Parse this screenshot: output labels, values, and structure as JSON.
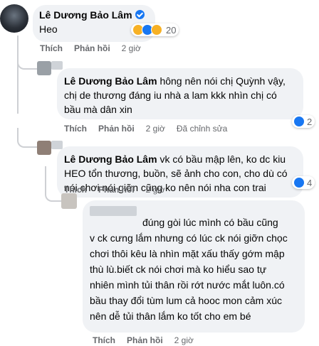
{
  "c1": {
    "author": "Lê Dương Bảo Lâm",
    "text": "Heo",
    "reaction_count": "20",
    "actions": {
      "like": "Thích",
      "reply": "Phản hồi",
      "time": "2 giờ"
    }
  },
  "c2": {
    "author": "Lê Dương Bảo Lâm",
    "lines": [
      "hông nên nói chị Quỳnh vậy,",
      "chị de thương đáng iu nhà a lam kkk nhìn chị có",
      "bầu mà dân xin"
    ],
    "reaction_count": "2",
    "actions": {
      "like": "Thích",
      "reply": "Phản hồi",
      "time": "2 giờ",
      "edited": "Đã chỉnh sửa"
    }
  },
  "c3": {
    "author": "Lê Dương Bảo Lâm",
    "lines": [
      "vk có bầu mập lên, ko dc kiu",
      "HEO tổn thương, buồn, sẽ ảnh cho con, cho dù có",
      "nói chơi nói giỡn cũng ko nên nói nha con trai"
    ],
    "reaction_count": "4",
    "actions": {
      "like": "Thích",
      "reply": "Phản hồi",
      "time": "2 giờ"
    }
  },
  "c4": {
    "lines": [
      "đúng gòi lúc mình có bầu cũng",
      "v ck cưng lắm nhưng có lúc ck nói giỡn chọc",
      "chơi thôi kêu là nhìn mặt xấu thấy gớm mập",
      "thù lù.biết ck nói chơi mà ko hiểu sao tự",
      "nhiên mình tủi thân rồi rớt nước mắt luôn.có",
      "bầu thay đổi tùm lum cả hooc mon cảm xúc",
      "nên dễ tủi thân lắm ko tốt cho em bé"
    ],
    "actions": {
      "like": "Thích",
      "reply": "Phản hồi",
      "time": "2 giờ"
    }
  }
}
